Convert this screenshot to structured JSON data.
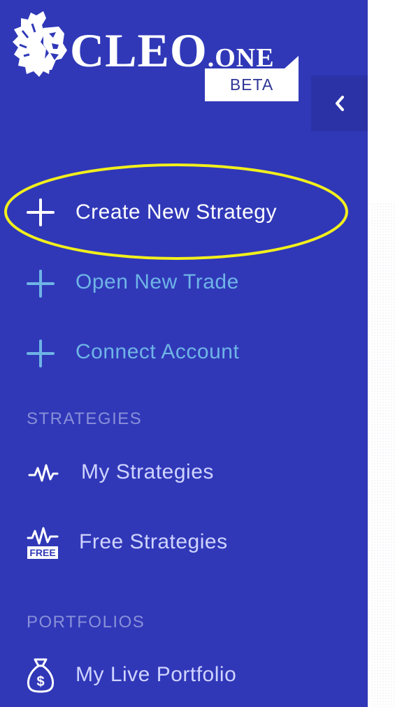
{
  "brand": {
    "name": "CLEO",
    "suffix": ".ONE",
    "badge": "BETA"
  },
  "sidebar": {
    "actions": [
      {
        "label": "Create New Strategy",
        "icon": "plus-icon"
      },
      {
        "label": "Open New Trade",
        "icon": "plus-icon"
      },
      {
        "label": "Connect Account",
        "icon": "plus-icon"
      }
    ],
    "sections": [
      {
        "header": "STRATEGIES",
        "items": [
          {
            "label": "My Strategies",
            "icon": "pulse-icon"
          },
          {
            "label": "Free Strategies",
            "icon": "free-pulse-icon"
          }
        ]
      },
      {
        "header": "PORTFOLIOS",
        "items": [
          {
            "label": "My Live Portfolio",
            "icon": "money-bag-icon"
          }
        ]
      }
    ]
  },
  "colors": {
    "sidebar_bg": "#3038b8",
    "highlight": "#f2ef1c",
    "cyan_text": "#6fb4e6"
  }
}
